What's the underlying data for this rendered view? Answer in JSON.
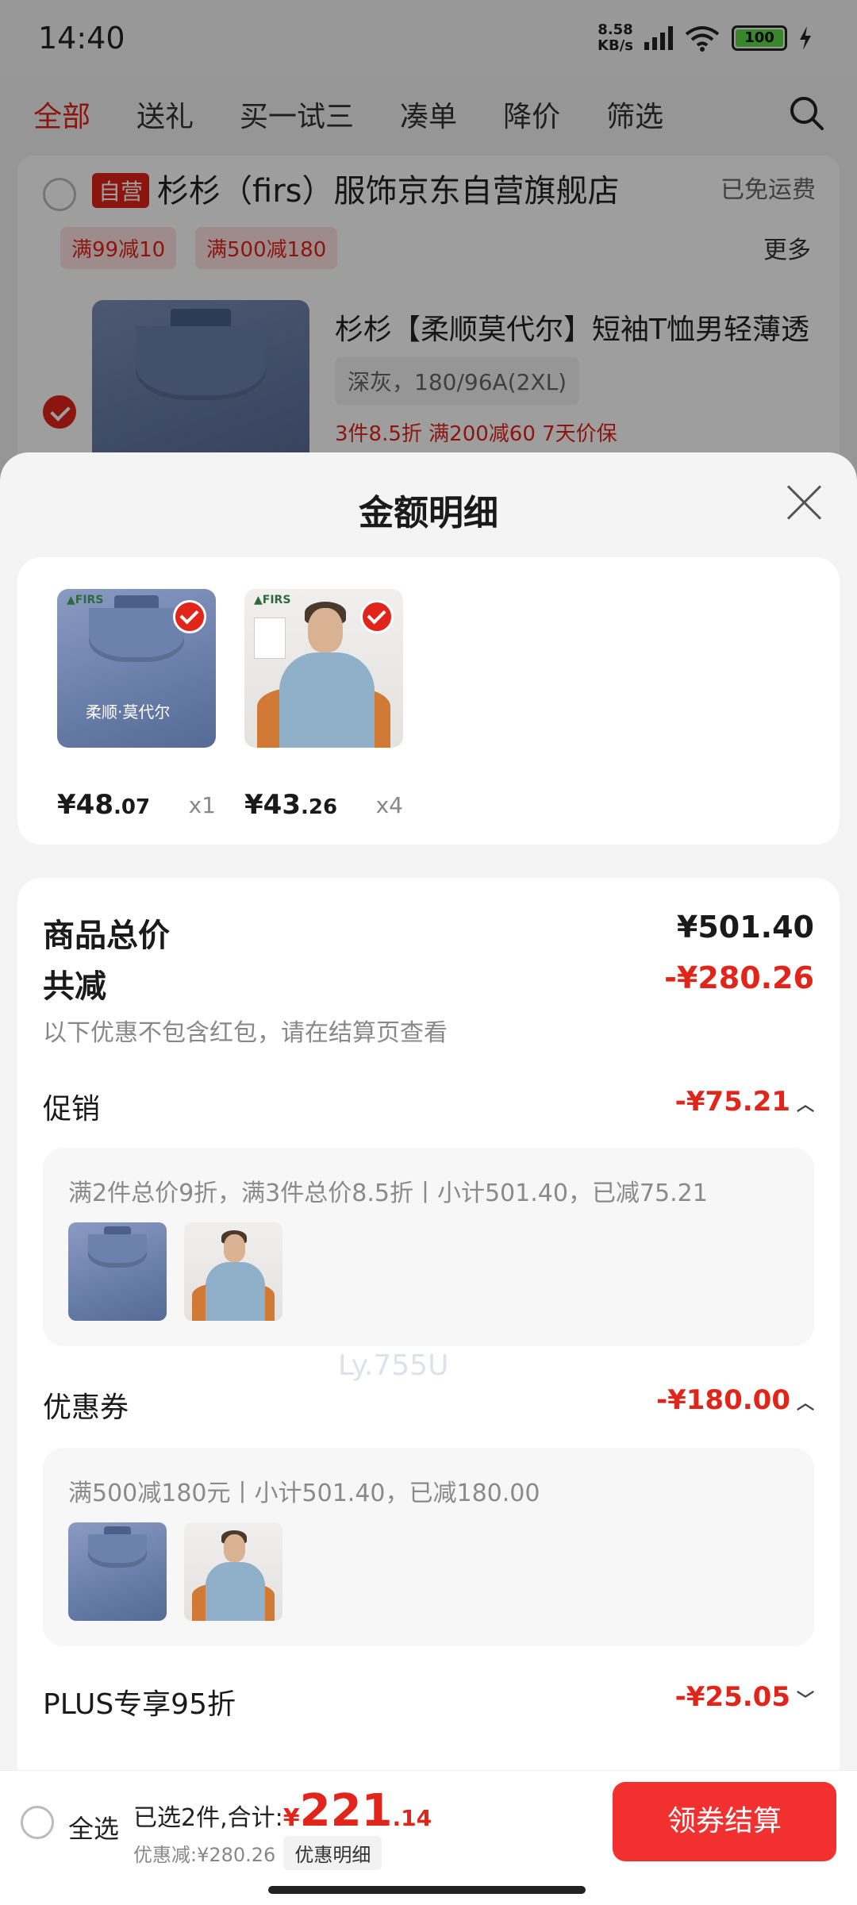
{
  "status_bar": {
    "time": "14:40",
    "net_speed_value": "8.58",
    "net_speed_unit": "KB/s",
    "battery": "100"
  },
  "tabs": [
    "全部",
    "送礼",
    "买一试三",
    "凑单",
    "降价",
    "筛选"
  ],
  "store": {
    "self_tag": "自营",
    "name": "杉杉（firs）服饰京东自营旗舰店",
    "free_shipping": "已免运费",
    "coupons": [
      "满99减10",
      "满500减180"
    ],
    "more": "更多"
  },
  "cart_product": {
    "title": "杉杉【柔顺莫代尔】短袖T恤男轻薄透",
    "spec": "深灰，180/96A(2XL)",
    "promo": "3件8.5折  满200减60  7天价保"
  },
  "sheet": {
    "title": "金额明细",
    "items": [
      {
        "price_int": "¥48",
        "price_dec": ".07",
        "qty": "x1",
        "img_caption": "柔顺·莫代尔"
      },
      {
        "price_int": "¥43",
        "price_dec": ".26",
        "qty": "x4",
        "img_caption": ""
      }
    ],
    "total_label": "商品总价",
    "total_value": "¥501.40",
    "reduce_label": "共减",
    "reduce_value": "-¥280.26",
    "reduce_note": "以下优惠不包含红包，请在结算页查看",
    "promo_label": "促销",
    "promo_value": "-¥75.21",
    "promo_detail": "满2件总价9折，满3件总价8.5折丨小计501.40，已减75.21",
    "coupon_label": "优惠券",
    "coupon_value": "-¥180.00",
    "coupon_detail": "满500减180元丨小计501.40，已减180.00",
    "plus_label": "PLUS专享95折",
    "plus_value": "-¥25.05",
    "watermark": "Ly.755U"
  },
  "checkout": {
    "select_all": "全选",
    "selected_prefix": "已选2件,合计:",
    "currency": "¥",
    "total_int": "221",
    "total_dec": ".14",
    "discount_text": "优惠减:¥280.26",
    "detail_chip": "优惠明细",
    "button": "领券结算"
  },
  "colors": {
    "accent_red": "#e1251b",
    "checkout_button": "#f2302f"
  }
}
